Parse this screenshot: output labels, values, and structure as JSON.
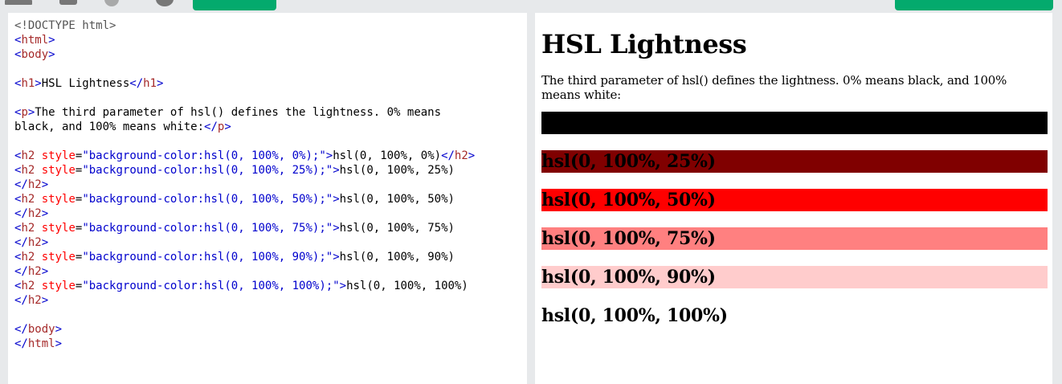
{
  "colors": {
    "run_button": "#04aa6d",
    "editor_bg": "#ffffff",
    "chrome_bg": "#e7e9eb",
    "tag_color": "#a52a2a",
    "bracket_color": "#0000cd",
    "attr_color": "#ff0000"
  },
  "toolbar": {
    "icons": [
      "menu-icon",
      "save-icon",
      "theme-icon",
      "rotate-icon"
    ]
  },
  "code_lines": [
    [
      {
        "t": "doctype",
        "v": "<!DOCTYPE html>"
      }
    ],
    [
      {
        "t": "bracket",
        "v": "<"
      },
      {
        "t": "tag",
        "v": "html"
      },
      {
        "t": "bracket",
        "v": ">"
      }
    ],
    [
      {
        "t": "bracket",
        "v": "<"
      },
      {
        "t": "tag",
        "v": "body"
      },
      {
        "t": "bracket",
        "v": ">"
      }
    ],
    [],
    [
      {
        "t": "bracket",
        "v": "<"
      },
      {
        "t": "tag",
        "v": "h1"
      },
      {
        "t": "bracket",
        "v": ">"
      },
      {
        "t": "text",
        "v": "HSL Lightness"
      },
      {
        "t": "bracket",
        "v": "</"
      },
      {
        "t": "tag",
        "v": "h1"
      },
      {
        "t": "bracket",
        "v": ">"
      }
    ],
    [],
    [
      {
        "t": "bracket",
        "v": "<"
      },
      {
        "t": "tag",
        "v": "p"
      },
      {
        "t": "bracket",
        "v": ">"
      },
      {
        "t": "text",
        "v": "The third parameter of hsl() defines the lightness. 0% means"
      }
    ],
    [
      {
        "t": "text",
        "v": "black, and 100% means white:"
      },
      {
        "t": "bracket",
        "v": "</"
      },
      {
        "t": "tag",
        "v": "p"
      },
      {
        "t": "bracket",
        "v": ">"
      }
    ],
    [],
    [
      {
        "t": "bracket",
        "v": "<"
      },
      {
        "t": "tag",
        "v": "h2 "
      },
      {
        "t": "attr",
        "v": "style"
      },
      {
        "t": "text",
        "v": "="
      },
      {
        "t": "val",
        "v": "\"background-color:hsl(0, 100%, 0%);\""
      },
      {
        "t": "bracket",
        "v": ">"
      },
      {
        "t": "text",
        "v": "hsl(0, 100%, 0%)"
      },
      {
        "t": "bracket",
        "v": "</"
      },
      {
        "t": "tag",
        "v": "h2"
      },
      {
        "t": "bracket",
        "v": ">"
      }
    ],
    [
      {
        "t": "bracket",
        "v": "<"
      },
      {
        "t": "tag",
        "v": "h2 "
      },
      {
        "t": "attr",
        "v": "style"
      },
      {
        "t": "text",
        "v": "="
      },
      {
        "t": "val",
        "v": "\"background-color:hsl(0, 100%, 25%);\""
      },
      {
        "t": "bracket",
        "v": ">"
      },
      {
        "t": "text",
        "v": "hsl(0, 100%, 25%)"
      }
    ],
    [
      {
        "t": "bracket",
        "v": "</"
      },
      {
        "t": "tag",
        "v": "h2"
      },
      {
        "t": "bracket",
        "v": ">"
      }
    ],
    [
      {
        "t": "bracket",
        "v": "<"
      },
      {
        "t": "tag",
        "v": "h2 "
      },
      {
        "t": "attr",
        "v": "style"
      },
      {
        "t": "text",
        "v": "="
      },
      {
        "t": "val",
        "v": "\"background-color:hsl(0, 100%, 50%);\""
      },
      {
        "t": "bracket",
        "v": ">"
      },
      {
        "t": "text",
        "v": "hsl(0, 100%, 50%)"
      }
    ],
    [
      {
        "t": "bracket",
        "v": "</"
      },
      {
        "t": "tag",
        "v": "h2"
      },
      {
        "t": "bracket",
        "v": ">"
      }
    ],
    [
      {
        "t": "bracket",
        "v": "<"
      },
      {
        "t": "tag",
        "v": "h2 "
      },
      {
        "t": "attr",
        "v": "style"
      },
      {
        "t": "text",
        "v": "="
      },
      {
        "t": "val",
        "v": "\"background-color:hsl(0, 100%, 75%);\""
      },
      {
        "t": "bracket",
        "v": ">"
      },
      {
        "t": "text",
        "v": "hsl(0, 100%, 75%)"
      }
    ],
    [
      {
        "t": "bracket",
        "v": "</"
      },
      {
        "t": "tag",
        "v": "h2"
      },
      {
        "t": "bracket",
        "v": ">"
      }
    ],
    [
      {
        "t": "bracket",
        "v": "<"
      },
      {
        "t": "tag",
        "v": "h2 "
      },
      {
        "t": "attr",
        "v": "style"
      },
      {
        "t": "text",
        "v": "="
      },
      {
        "t": "val",
        "v": "\"background-color:hsl(0, 100%, 90%);\""
      },
      {
        "t": "bracket",
        "v": ">"
      },
      {
        "t": "text",
        "v": "hsl(0, 100%, 90%)"
      }
    ],
    [
      {
        "t": "bracket",
        "v": "</"
      },
      {
        "t": "tag",
        "v": "h2"
      },
      {
        "t": "bracket",
        "v": ">"
      }
    ],
    [
      {
        "t": "bracket",
        "v": "<"
      },
      {
        "t": "tag",
        "v": "h2 "
      },
      {
        "t": "attr",
        "v": "style"
      },
      {
        "t": "text",
        "v": "="
      },
      {
        "t": "val",
        "v": "\"background-color:hsl(0, 100%, 100%);\""
      },
      {
        "t": "bracket",
        "v": ">"
      },
      {
        "t": "text",
        "v": "hsl(0, 100%, 100%)"
      }
    ],
    [
      {
        "t": "bracket",
        "v": "</"
      },
      {
        "t": "tag",
        "v": "h2"
      },
      {
        "t": "bracket",
        "v": ">"
      }
    ],
    [],
    [
      {
        "t": "bracket",
        "v": "</"
      },
      {
        "t": "tag",
        "v": "body"
      },
      {
        "t": "bracket",
        "v": ">"
      }
    ],
    [
      {
        "t": "bracket",
        "v": "</"
      },
      {
        "t": "tag",
        "v": "html"
      },
      {
        "t": "bracket",
        "v": ">"
      }
    ]
  ],
  "result": {
    "h1": "HSL Lightness",
    "paragraph": "The third parameter of hsl() defines the lightness. 0% means black, and 100% means white:",
    "headings": [
      {
        "text": "hsl(0, 100%, 0%)",
        "color": "hsl(0, 100%, 0%)"
      },
      {
        "text": "hsl(0, 100%, 25%)",
        "color": "hsl(0, 100%, 25%)"
      },
      {
        "text": "hsl(0, 100%, 50%)",
        "color": "hsl(0, 100%, 50%)"
      },
      {
        "text": "hsl(0, 100%, 75%)",
        "color": "hsl(0, 100%, 75%)"
      },
      {
        "text": "hsl(0, 100%, 90%)",
        "color": "hsl(0, 100%, 90%)"
      },
      {
        "text": "hsl(0, 100%, 100%)",
        "color": "hsl(0, 100%, 100%)"
      }
    ]
  }
}
